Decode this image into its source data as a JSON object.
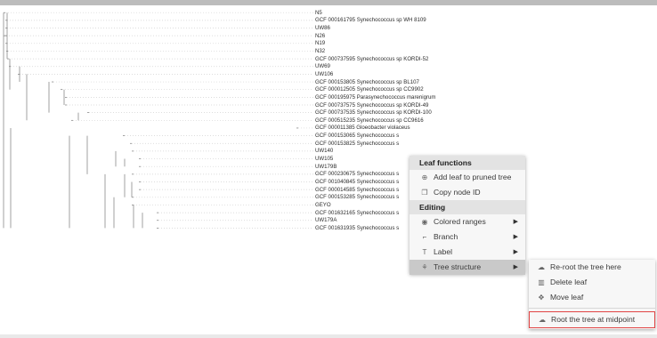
{
  "tree": {
    "leaves": [
      "N5",
      "GCF 000161795 Synechococcus sp WH 8109",
      "UW86",
      "N26",
      "N19",
      "N32",
      "GCF 000737595 Synechococcus sp KORDI-52",
      "UW69",
      "UW106",
      "GCF 000153805 Synechococcus sp BL107",
      "GCF 000012505 Synechococcus sp CC9902",
      "GCF 000195975 Parasynechococcus marenigrum",
      "GCF 000737575 Synechococcus sp KORDI-49",
      "GCF 000737535 Synechococcus sp KORDI-100",
      "GCF 000515235 Synechococcus sp CC9616",
      "GCF 000011385 Gloeobacter violaceus",
      "GCF 000153065 Synechococcus s",
      "GCF 000153825 Synechococcus s",
      "UW140",
      "UW105",
      "UW179B",
      "GCF 000230675 Synechococcus s",
      "GCF 001040845 Synechococcus s",
      "GCF 000014585 Synechococcus s",
      "GCF 000153285 Synechococcus s",
      "GEYO",
      "GCF 001632165 Synechococcus s",
      "UW179A",
      "GCF 001631935 Synechococcus s"
    ]
  },
  "context_menu": {
    "leaf_functions_header": "Leaf functions",
    "add_leaf": "Add leaf to pruned tree",
    "copy_node_id": "Copy node ID",
    "editing_header": "Editing",
    "colored_ranges": "Colored ranges",
    "branch": "Branch",
    "label": "Label",
    "tree_structure": "Tree structure",
    "icons": {
      "add_leaf": "plus-circle-icon",
      "copy": "copy-icon",
      "colored_ranges": "palette-icon",
      "branch": "branch-icon",
      "label": "text-label-icon",
      "tree_structure": "tree-icon"
    }
  },
  "submenu": {
    "reroot": "Re-root the tree here",
    "delete_leaf": "Delete leaf",
    "move_leaf": "Move leaf",
    "root_midpoint": "Root the tree at midpoint",
    "highlight_color": "#e04444"
  }
}
